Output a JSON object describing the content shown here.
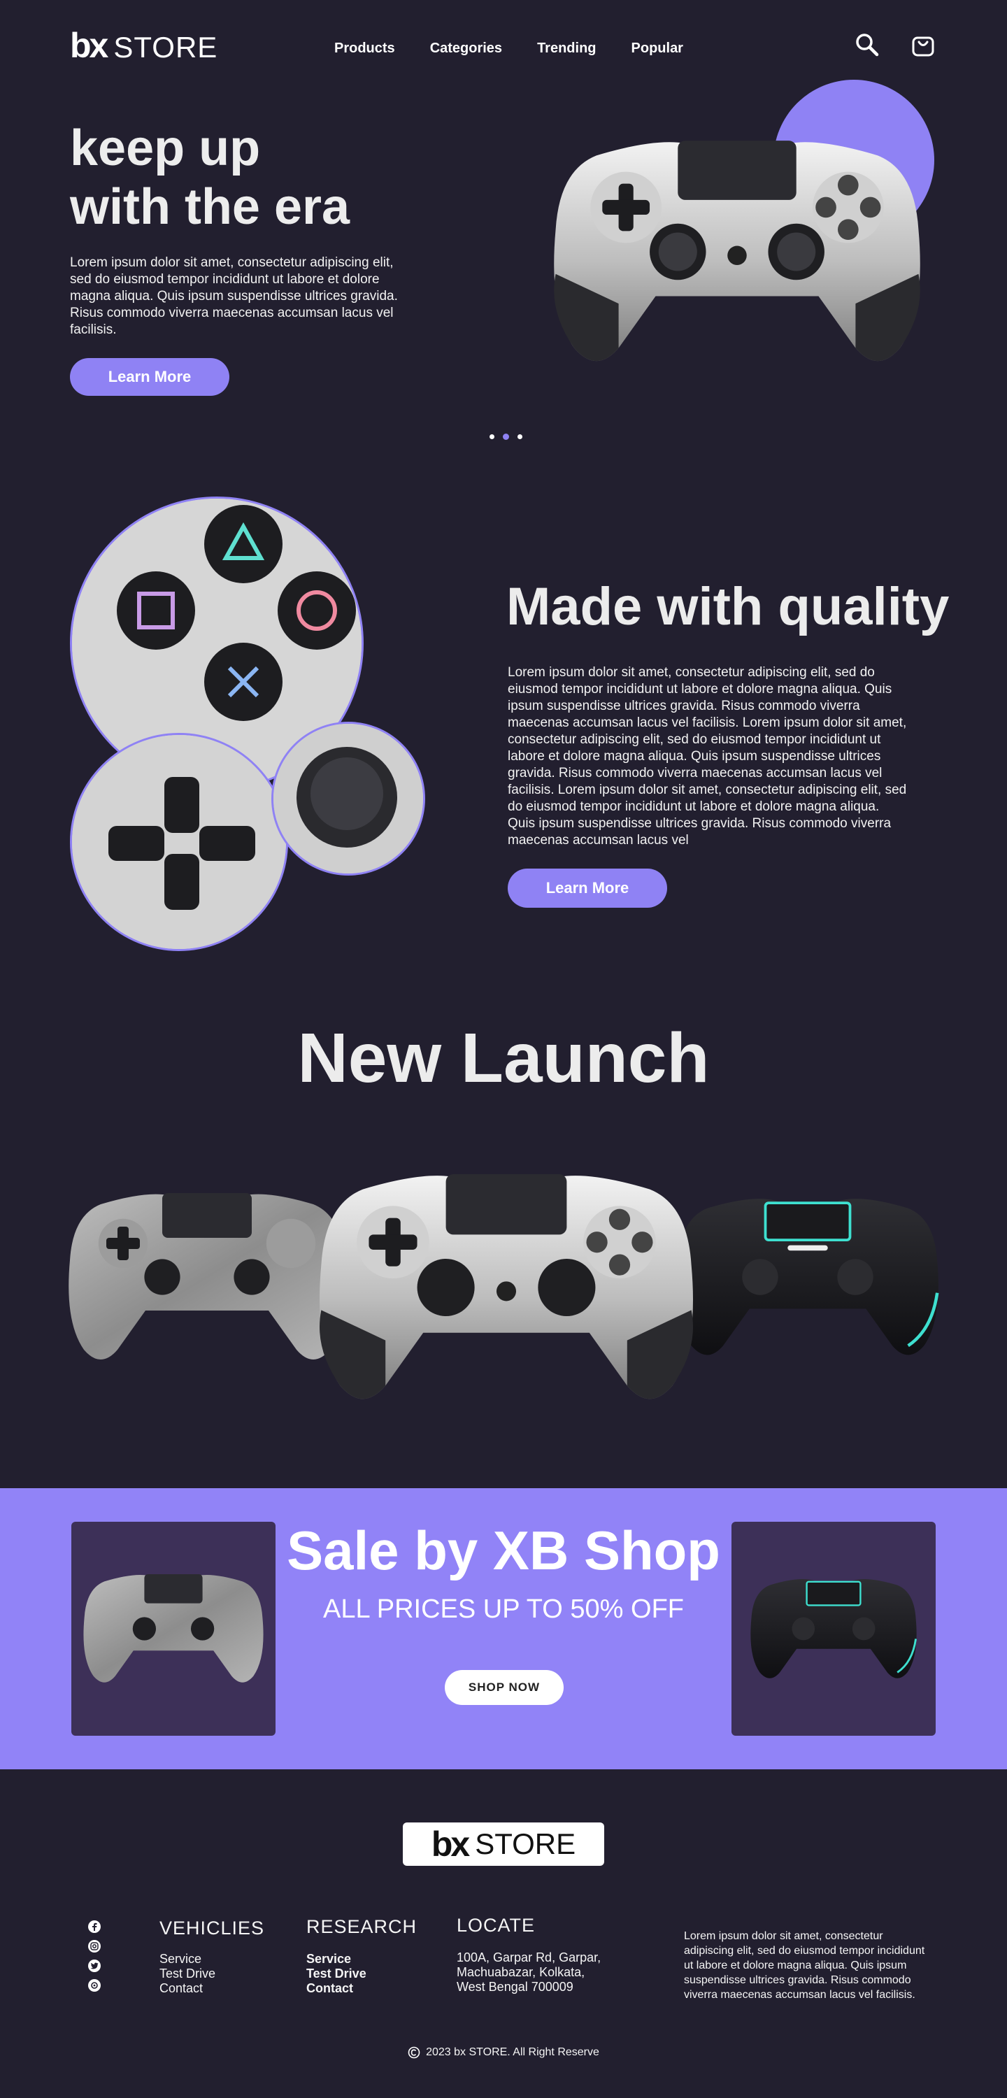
{
  "header": {
    "logo_bold": "bx",
    "logo_text": "STORE",
    "nav": [
      "Products",
      "Categories",
      "Trending",
      "Popular"
    ],
    "icons": [
      "search-icon",
      "cart-icon"
    ]
  },
  "hero": {
    "title_line1": "keep up",
    "title_line2": "with the era",
    "text": "Lorem ipsum dolor sit amet, consectetur adipiscing elit, sed do eiusmod tempor incididunt ut labore et dolore magna aliqua. Quis ipsum suspendisse ultrices gravida. Risus commodo viverra maecenas accumsan lacus vel facilisis.",
    "button": "Learn More",
    "carousel": {
      "count": 3,
      "active": 2
    }
  },
  "quality": {
    "title": "Made with quality",
    "text": "Lorem ipsum dolor sit amet, consectetur adipiscing elit, sed do eiusmod tempor incididunt ut labore et dolore magna aliqua. Quis ipsum suspendisse ultrices gravida. Risus commodo viverra maecenas accumsan lacus vel facilisis. Lorem ipsum dolor sit amet, consectetur adipiscing elit, sed do eiusmod tempor incididunt ut labore et dolore magna aliqua. Quis ipsum suspendisse ultrices gravida. Risus commodo viverra maecenas accumsan lacus vel facilisis. Lorem ipsum dolor sit amet, consectetur adipiscing elit, sed do eiusmod tempor incididunt ut labore et dolore magna aliqua. Quis ipsum suspendisse ultrices gravida. Risus commodo viverra maecenas accumsan lacus vel",
    "button": "Learn More"
  },
  "launch": {
    "title": "New Launch"
  },
  "sale": {
    "title": "Sale by XB Shop",
    "subtitle": "ALL PRICES UP TO 50% OFF",
    "button": "SHOP NOW"
  },
  "footer": {
    "logo_bold": "bx",
    "logo_text": "STORE",
    "social": [
      "facebook-icon",
      "instagram-icon",
      "twitter-icon",
      "pinterest-icon"
    ],
    "col1": {
      "title": "VEHICLIES",
      "links": [
        "Service",
        "Test Drive",
        "Contact"
      ]
    },
    "col2": {
      "title": "RESEARCH",
      "links": [
        "Service",
        "Test Drive",
        "Contact"
      ]
    },
    "col3": {
      "title": "LOCATE",
      "lines": [
        "100A, Garpar Rd, Garpar,",
        "Machuabazar, Kolkata,",
        "West Bengal 700009"
      ]
    },
    "about": "Lorem ipsum dolor sit amet, consectetur adipiscing elit, sed do eiusmod tempor incididunt ut labore et dolore magna aliqua. Quis ipsum suspendisse ultrices gravida. Risus commodo viverra maecenas accumsan lacus vel facilisis.",
    "copyright": "2023 bx STORE. All Right Reserve"
  },
  "colors": {
    "bg": "#221f2f",
    "accent": "#8f82f4",
    "sale_bg": "#9183f7",
    "card": "#3d3058"
  }
}
